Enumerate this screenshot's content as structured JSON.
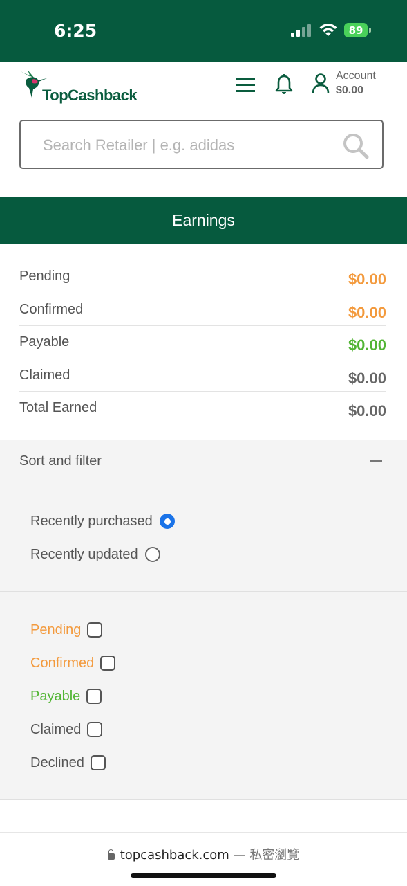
{
  "status_bar": {
    "time": "6:25",
    "battery": "89"
  },
  "header": {
    "logo_text": "TopCashback",
    "account_label": "Account",
    "account_balance": "$0.00"
  },
  "search": {
    "placeholder": "Search Retailer | e.g. adidas"
  },
  "earnings": {
    "title": "Earnings",
    "rows": [
      {
        "label": "Pending",
        "value": "$0.00",
        "color": "#f39a3d"
      },
      {
        "label": "Confirmed",
        "value": "$0.00",
        "color": "#f39a3d"
      },
      {
        "label": "Payable",
        "value": "$0.00",
        "color": "#52b534"
      },
      {
        "label": "Claimed",
        "value": "$0.00",
        "color": "#666666"
      },
      {
        "label": "Total Earned",
        "value": "$0.00",
        "color": "#666666"
      }
    ]
  },
  "sort_filter": {
    "title": "Sort and filter",
    "sort_options": [
      {
        "label": "Recently purchased",
        "selected": true
      },
      {
        "label": "Recently updated",
        "selected": false
      }
    ],
    "status_filters": [
      {
        "label": "Pending",
        "color": "#f39a3d",
        "checked": false
      },
      {
        "label": "Confirmed",
        "color": "#f39a3d",
        "checked": false
      },
      {
        "label": "Payable",
        "color": "#52b534",
        "checked": false
      },
      {
        "label": "Claimed",
        "color": "#555555",
        "checked": false
      },
      {
        "label": "Declined",
        "color": "#555555",
        "checked": false
      }
    ]
  },
  "browser": {
    "url": "topcashback.com",
    "separator": "—",
    "mode": "私密瀏覽"
  },
  "colors": {
    "brand": "#065a3e",
    "accent_radio": "#1a73e8"
  }
}
